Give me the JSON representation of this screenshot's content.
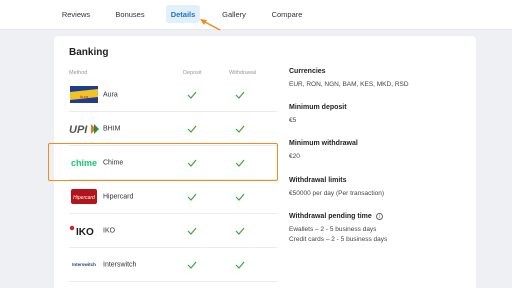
{
  "tabs": [
    "Reviews",
    "Bonuses",
    "Details",
    "Gallery",
    "Compare"
  ],
  "banking": {
    "title": "Banking",
    "columns": {
      "method": "Method",
      "deposit": "Deposit",
      "withdrawal": "Withdrawal"
    },
    "methods": [
      {
        "name": "Aura",
        "logo_text": "Aura",
        "deposit": true,
        "withdrawal": true
      },
      {
        "name": "BHIM",
        "logo_text": "UPI",
        "deposit": true,
        "withdrawal": true
      },
      {
        "name": "Chime",
        "logo_text": "chime",
        "deposit": true,
        "withdrawal": true
      },
      {
        "name": "Hipercard",
        "logo_text": "Hipercard",
        "deposit": true,
        "withdrawal": true
      },
      {
        "name": "IKO",
        "logo_text": "IKO",
        "deposit": true,
        "withdrawal": true
      },
      {
        "name": "Interswitch",
        "logo_text": "Interswitch",
        "deposit": true,
        "withdrawal": true
      }
    ]
  },
  "info": {
    "currencies_label": "Currencies",
    "currencies_value": "EUR, RON, NGN, BAM, KES, MKD, RSD",
    "min_deposit_label": "Minimum deposit",
    "min_deposit_value": "€5",
    "min_withdrawal_label": "Minimum withdrawal",
    "min_withdrawal_value": "€20",
    "withdrawal_limits_label": "Withdrawal limits",
    "withdrawal_limits_value": "€50000 per day (Per transaction)",
    "pending_label": "Withdrawal pending time",
    "pending_ewallets": "Ewallets – 2 - 5 business days",
    "pending_cards": "Credit cards – 2 - 5 business days"
  },
  "colors": {
    "accent": "#1677c8",
    "check": "#3aaa35",
    "highlight": "#f28c1c",
    "chime": "#1ec677"
  }
}
